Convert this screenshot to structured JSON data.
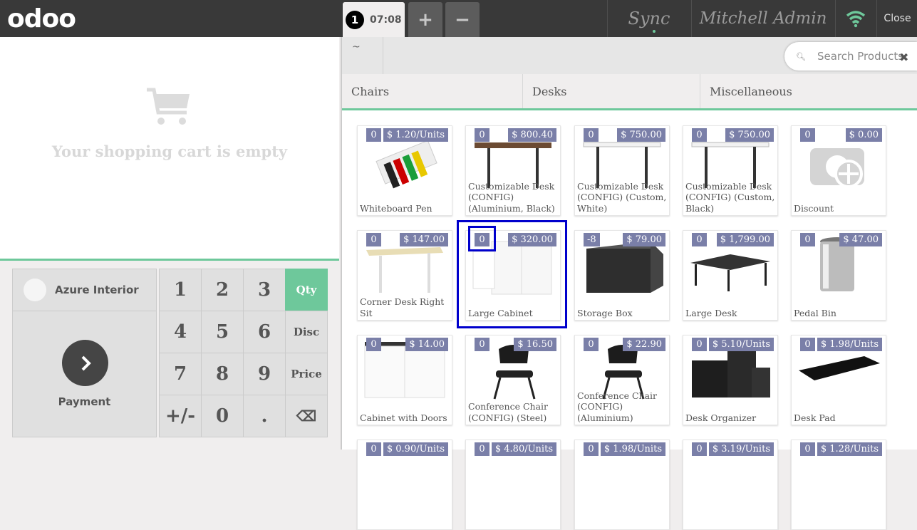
{
  "header": {
    "logo": "odoo",
    "order_number": "1",
    "order_time": "07:08",
    "add_order_label": "+",
    "remove_order_label": "−",
    "sync_label": "Sync",
    "user_name": "Mitchell Admin",
    "close_label": "Close"
  },
  "cart": {
    "empty_message": "Your shopping cart is empty"
  },
  "actionpad": {
    "customer": "Azure Interior",
    "payment": "Payment"
  },
  "numpad": {
    "keys": [
      "1",
      "2",
      "3",
      "4",
      "5",
      "6",
      "7",
      "8",
      "9",
      "+/-",
      "0",
      "."
    ],
    "modes": [
      "Qty",
      "Disc",
      "Price"
    ],
    "active_mode": "Qty",
    "backspace": "⌫"
  },
  "breadcrumb": {
    "home": "~"
  },
  "search": {
    "placeholder": "Search Products"
  },
  "categories": [
    "Chairs",
    "Desks",
    "Miscellaneous"
  ],
  "products": [
    {
      "name": "Whiteboard Pen",
      "qty": "0",
      "price": "$ 1.20/Units"
    },
    {
      "name": "Customizable Desk (CONFIG) (Aluminium, Black)",
      "qty": "0",
      "price": "$ 800.40"
    },
    {
      "name": "Customizable Desk (CONFIG) (Custom, White)",
      "qty": "0",
      "price": "$ 750.00"
    },
    {
      "name": "Customizable Desk (CONFIG) (Custom, Black)",
      "qty": "0",
      "price": "$ 750.00"
    },
    {
      "name": "Discount",
      "qty": "0",
      "price": "$ 0.00"
    },
    {
      "name": "Corner Desk Right Sit",
      "qty": "0",
      "price": "$ 147.00"
    },
    {
      "name": "Large Cabinet",
      "qty": "0",
      "price": "$ 320.00"
    },
    {
      "name": "Storage Box",
      "qty": "-8",
      "price": "$ 79.00"
    },
    {
      "name": "Large Desk",
      "qty": "0",
      "price": "$ 1,799.00"
    },
    {
      "name": "Pedal Bin",
      "qty": "0",
      "price": "$ 47.00"
    },
    {
      "name": "Cabinet with Doors",
      "qty": "0",
      "price": "$ 14.00"
    },
    {
      "name": "Conference Chair (CONFIG) (Steel)",
      "qty": "0",
      "price": "$ 16.50"
    },
    {
      "name": "Conference Chair (CONFIG) (Aluminium)",
      "qty": "0",
      "price": "$ 22.90"
    },
    {
      "name": "Desk Organizer",
      "qty": "0",
      "price": "$ 5.10/Units"
    },
    {
      "name": "Desk Pad",
      "qty": "0",
      "price": "$ 1.98/Units"
    },
    {
      "name": "",
      "qty": "0",
      "price": "$ 0.90/Units"
    },
    {
      "name": "",
      "qty": "0",
      "price": "$ 4.80/Units"
    },
    {
      "name": "",
      "qty": "0",
      "price": "$ 1.98/Units"
    },
    {
      "name": "",
      "qty": "0",
      "price": "$ 3.19/Units"
    },
    {
      "name": "",
      "qty": "0",
      "price": "$ 1.28/Units"
    }
  ],
  "colors": {
    "accent": "#6ec89b",
    "badge": "#7a7fa8",
    "highlight": "#0000cc"
  }
}
